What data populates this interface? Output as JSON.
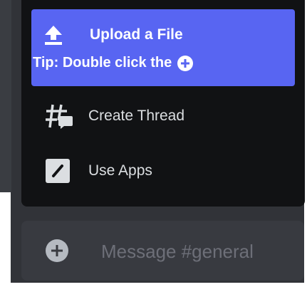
{
  "menu": {
    "upload": {
      "label": "Upload a File",
      "tip": "Tip: Double click the",
      "icon": "upload-icon",
      "tip_icon": "plus-circle-icon"
    },
    "create_thread": {
      "label": "Create Thread",
      "icon": "thread-icon"
    },
    "use_apps": {
      "label": "Use Apps",
      "icon": "apps-icon"
    }
  },
  "composer": {
    "placeholder": "Message #general",
    "add_icon": "plus-circle-icon"
  },
  "colors": {
    "highlight": "#5865f2",
    "menu_background": "#111214",
    "app_background": "#313338",
    "composer_background": "#383a40",
    "text": "#dbdee1",
    "placeholder": "#6d6f78"
  }
}
